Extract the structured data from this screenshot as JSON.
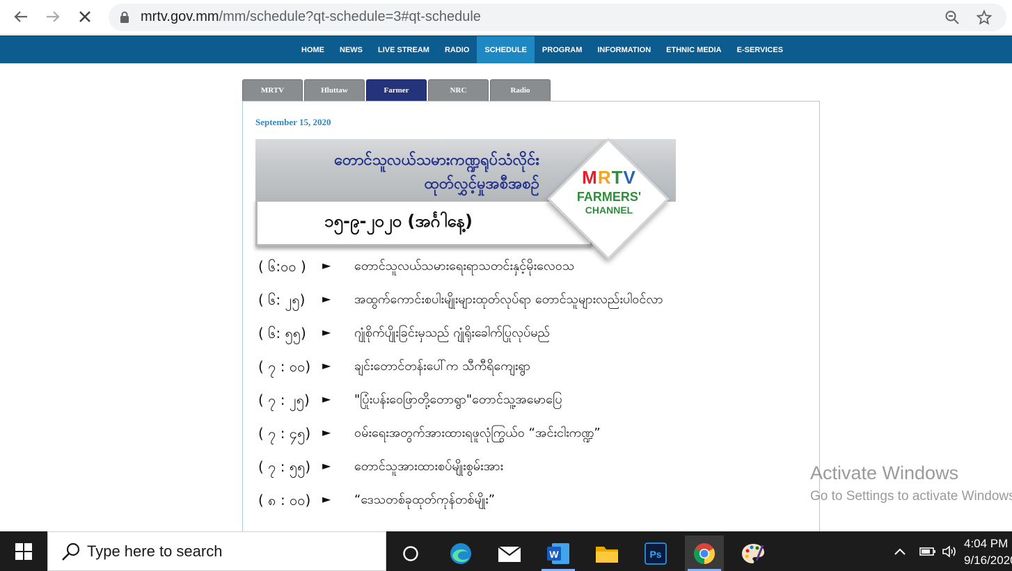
{
  "browser": {
    "url_domain": "mrtv.gov.mm",
    "url_path": "/mm/schedule?qt-schedule=3#qt-schedule"
  },
  "site_menu": [
    {
      "label": "HOME",
      "active": false
    },
    {
      "label": "NEWS",
      "active": false
    },
    {
      "label": "LIVE STREAM",
      "active": false
    },
    {
      "label": "RADIO",
      "active": false
    },
    {
      "label": "SCHEDULE",
      "active": true
    },
    {
      "label": "PROGRAM",
      "active": false
    },
    {
      "label": "INFORMATION",
      "active": false
    },
    {
      "label": "ETHNIC MEDIA",
      "active": false
    },
    {
      "label": "E-SERVICES",
      "active": false
    }
  ],
  "tabs": [
    {
      "label": "MRTV",
      "active": false
    },
    {
      "label": "Hluttaw",
      "active": false
    },
    {
      "label": "Farmer",
      "active": true
    },
    {
      "label": "NRC",
      "active": false
    },
    {
      "label": "Radio",
      "active": false
    }
  ],
  "content": {
    "date": "September 15, 2020",
    "banner": {
      "title_line1": "တောင်သူလယ်သမားကဏ္ဍရုပ်သံလိုင်း",
      "title_line2": "ထုတ်လွှင့်မှုအစီအစဉ်",
      "date_text": "၁၅-၉-၂၀၂၀ (အင်္ဂါနေ့)",
      "logo_mrtv": [
        "M",
        "R",
        "T",
        "V"
      ],
      "logo_farmers": "FARMERS'",
      "logo_channel": "CHANNEL"
    },
    "schedule": [
      {
        "time": "( ၆:၀၀ )",
        "title": "တောင်သူလယ်သမားရေးရာသတင်းနှင့်မိုးလေဝသ"
      },
      {
        "time": "( ၆: ၂၅)",
        "title": "အထွက်ကောင်းစပါးမျိုးများထုတ်လုပ်ရာ တောင်သူများလည်းပါဝင်လာ"
      },
      {
        "time": "( ၆: ၅၅)",
        "title": "ဂျုံစိုက်ပျိုးခြင်းမှသည် ဂျုံရိုးခေါက်ပြုလုပ်မည်"
      },
      {
        "time": "( ၇ : ၀၀)",
        "title": "ချင်းတောင်တန်းပေါ်က သီကီရိကျေးရွာ"
      },
      {
        "time": "( ၇ : ၂၅)",
        "title": "\"ပြုံးပန်းဝေဖြာတို့တောရွာ\"တောင်သူ့အမောပြေ"
      },
      {
        "time": "( ၇ : ၄၅)",
        "title": "ဝမ်းရေးအတွက်အားထားရဖူလုံကြွယ်ဝ “အင်းငါးကဏ္ဍ”"
      },
      {
        "time": "( ၇ : ၅၅)",
        "title": "တောင်သူအားထားစပ်မျိုးစွမ်းအား"
      },
      {
        "time": "( ၈ : ၀၀)",
        "title": "“ဒေသတစ်ခုထုတ်ကုန်တစ်မျိုး”"
      }
    ]
  },
  "watermark": {
    "line1": "Activate Windows",
    "line2": "Go to Settings to activate Windows."
  },
  "taskbar": {
    "search_placeholder": "Type here to search",
    "word_label": "W",
    "ps_label": "Ps",
    "time": "4:04 PM",
    "date": "9/16/2020"
  },
  "colors": {
    "menu_bg": "#0d5c8f",
    "menu_active": "#1e88c4",
    "tab_active": "#24337a",
    "date_color": "#2d88c5",
    "banner_title": "#22308a"
  }
}
